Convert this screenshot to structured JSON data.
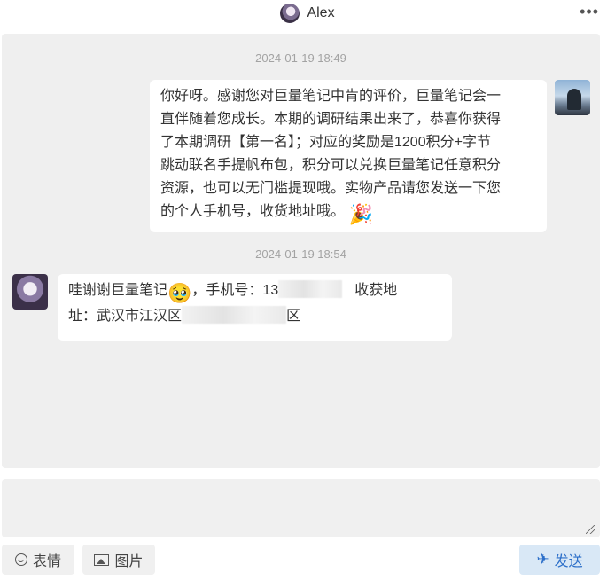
{
  "header": {
    "name": "Alex",
    "more_icon": "more-dots-icon",
    "more_label": "•••"
  },
  "messages": [
    {
      "timestamp": "2024-01-19 18:49",
      "side": "right",
      "lines": [
        "你好呀。感谢您对巨量笔记中肯的评价，巨量笔记会一",
        "直伴随着您成长。本期的调研结果出来了，恭喜你获得",
        "了本期调研【第一名】；对应的奖励是1200积分+字节",
        "跳动联名手提帆布包，积分可以兑换巨量笔记任意积分",
        "资源，也可以无门槛提现哦。实物产品请您发送一下您",
        "的个人手机号，收货地址哦。"
      ],
      "emoji": "🎉",
      "emoji_name": "party-popper-icon"
    },
    {
      "timestamp": "2024-01-19 18:54",
      "side": "left",
      "line1_a": "哇谢谢巨量笔记",
      "emoji": "🥹",
      "emoji_name": "teary-face-icon",
      "line1_b": "，手机号：13",
      "line1_c": "收获地",
      "line2_a": "址：武汉市江汉区",
      "line2_b": "区"
    }
  ],
  "toolbar": {
    "emoji_label": "表情",
    "image_label": "图片",
    "send_label": "发送",
    "send_icon": "✈"
  },
  "colors": {
    "accent": "#2c6fc9",
    "chat_bg": "#efefef",
    "send_bg": "#d9e8f6"
  }
}
